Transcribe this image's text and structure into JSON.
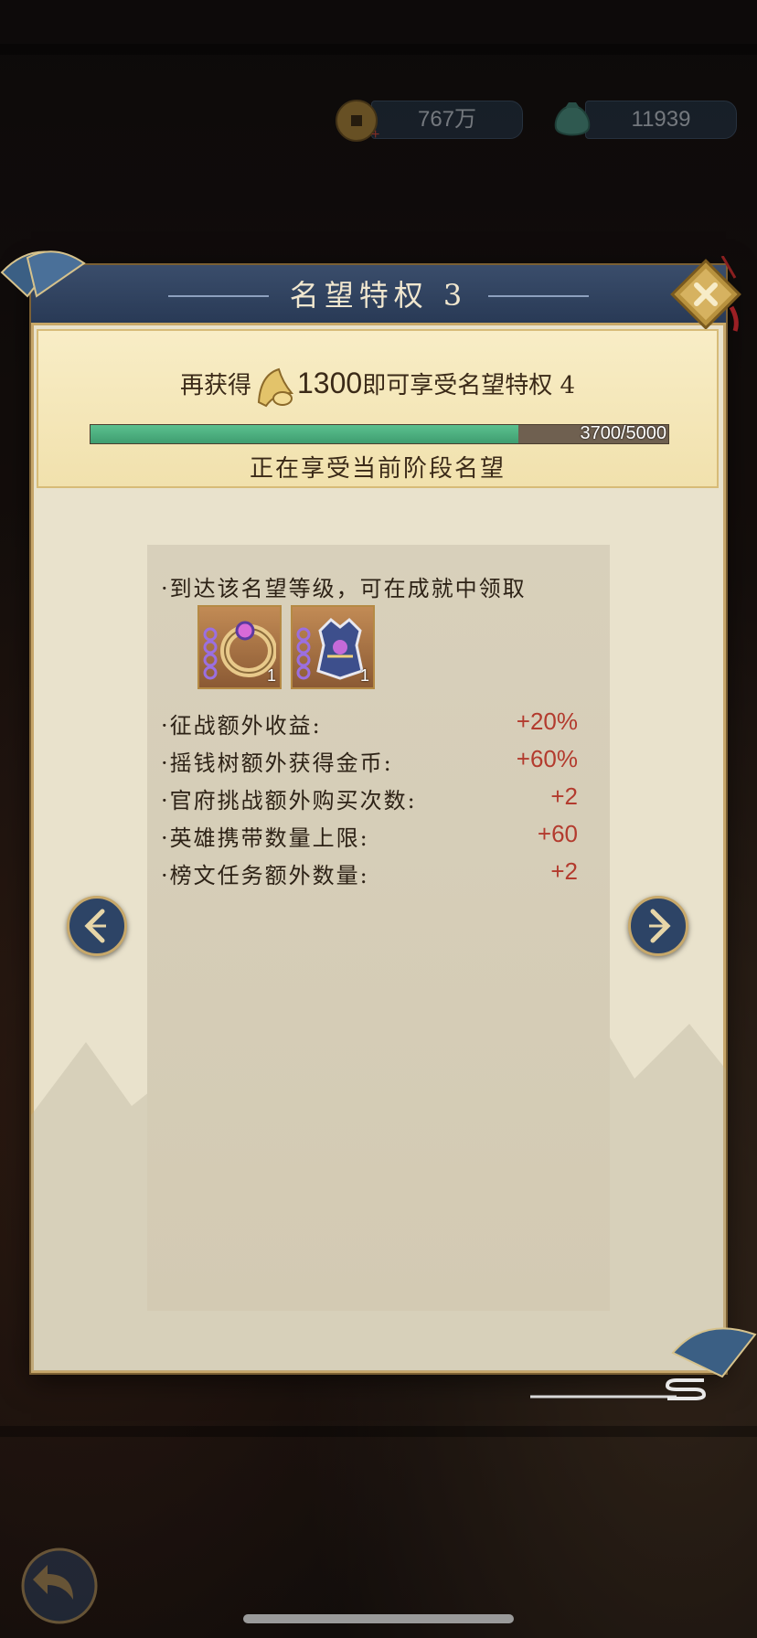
{
  "currency": {
    "coins": {
      "icon": "coin-icon",
      "value": "767万"
    },
    "bag": {
      "icon": "money-bag-icon",
      "value": "11939"
    }
  },
  "panel": {
    "title": "名望特权 3",
    "requirement": {
      "prefix": "再获得",
      "icon": "horn-icon",
      "amount": "1300",
      "suffix": "即可享受名望特权 4"
    },
    "progress": {
      "current": 3700,
      "max": 5000,
      "label": "3700/5000",
      "fraction": 0.74
    },
    "status": "正在享受当前阶段名望"
  },
  "rewards": {
    "header": "·到达该名望等级，可在成就中领取",
    "items": [
      {
        "name": "ring-icon",
        "count": "1"
      },
      {
        "name": "armor-icon",
        "count": "1"
      }
    ]
  },
  "stats": [
    {
      "label": "·征战额外收益:",
      "value": "+20%"
    },
    {
      "label": "·摇钱树额外获得金币:",
      "value": "+60%"
    },
    {
      "label": "·官府挑战额外购买次数:",
      "value": "+2"
    },
    {
      "label": "·英雄携带数量上限:",
      "value": "+60"
    },
    {
      "label": "·榜文任务额外数量:",
      "value": "+2"
    }
  ],
  "colors": {
    "accent_gold": "#c6a66a",
    "header_blue": "#2f4260",
    "value_red": "#b33b2e",
    "progress_green": "#4fb184"
  }
}
